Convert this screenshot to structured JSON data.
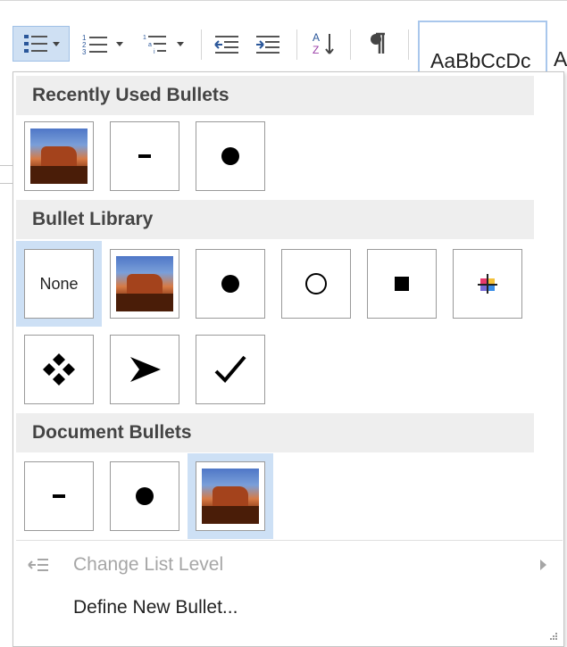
{
  "ribbon": {
    "style_preview": "AaBbCcDc",
    "style_preview_next": "A"
  },
  "sections": {
    "recently_used": "Recently Used Bullets",
    "library": "Bullet Library",
    "document": "Document Bullets"
  },
  "library": {
    "none_label": "None"
  },
  "menu": {
    "change_list_level": "Change List Level",
    "define_new_bullet": "Define New Bullet..."
  },
  "colors": {
    "highlight": "#cde0f5",
    "header_bg": "#eeeeee",
    "header_text": "#444444",
    "disabled_text": "#a6a6a6"
  },
  "icons": {
    "bullets": "bullets-icon",
    "numbering": "numbering-icon",
    "multilevel": "multilevel-list-icon",
    "decrease_indent": "decrease-indent-icon",
    "increase_indent": "increase-indent-icon",
    "sort": "sort-icon",
    "pilcrow": "show-formatting-icon"
  }
}
